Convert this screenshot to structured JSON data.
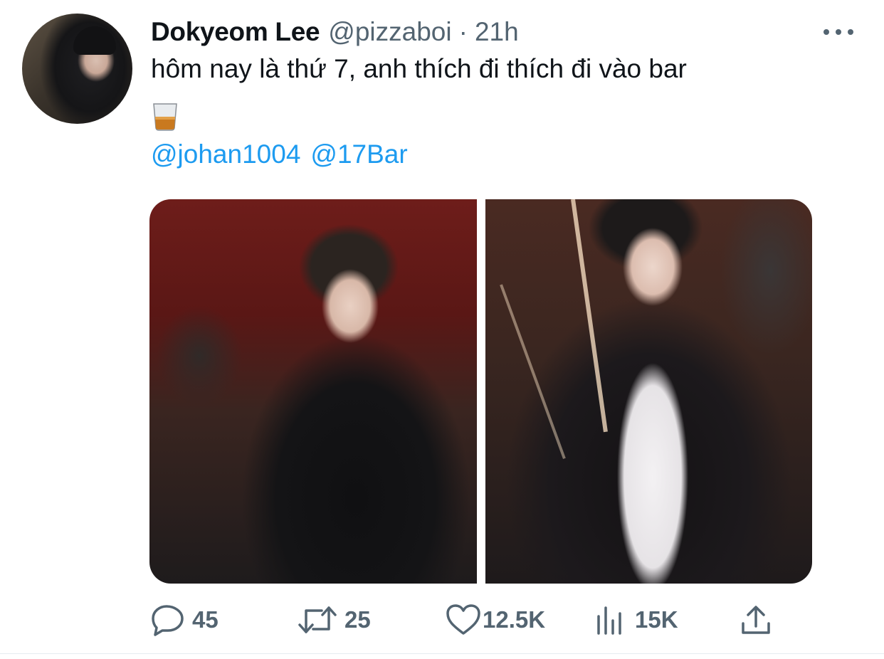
{
  "tweet": {
    "display_name": "Dokyeom Lee",
    "handle": "@pizzaboi",
    "separator": "·",
    "time": "21h",
    "text": "hôm nay là thứ 7, anh thích đi thích đi vào bar",
    "emoji": "tumbler-glass-icon",
    "mentions": [
      "@johan1004",
      "@17Bar"
    ],
    "media_count": 2
  },
  "actions": {
    "replies": "45",
    "retweets": "25",
    "likes": "12.5K",
    "views": "15K"
  },
  "colors": {
    "text": "#0f1419",
    "secondary": "#536471",
    "link": "#1d9bf0",
    "divider": "#e6ecf0"
  }
}
